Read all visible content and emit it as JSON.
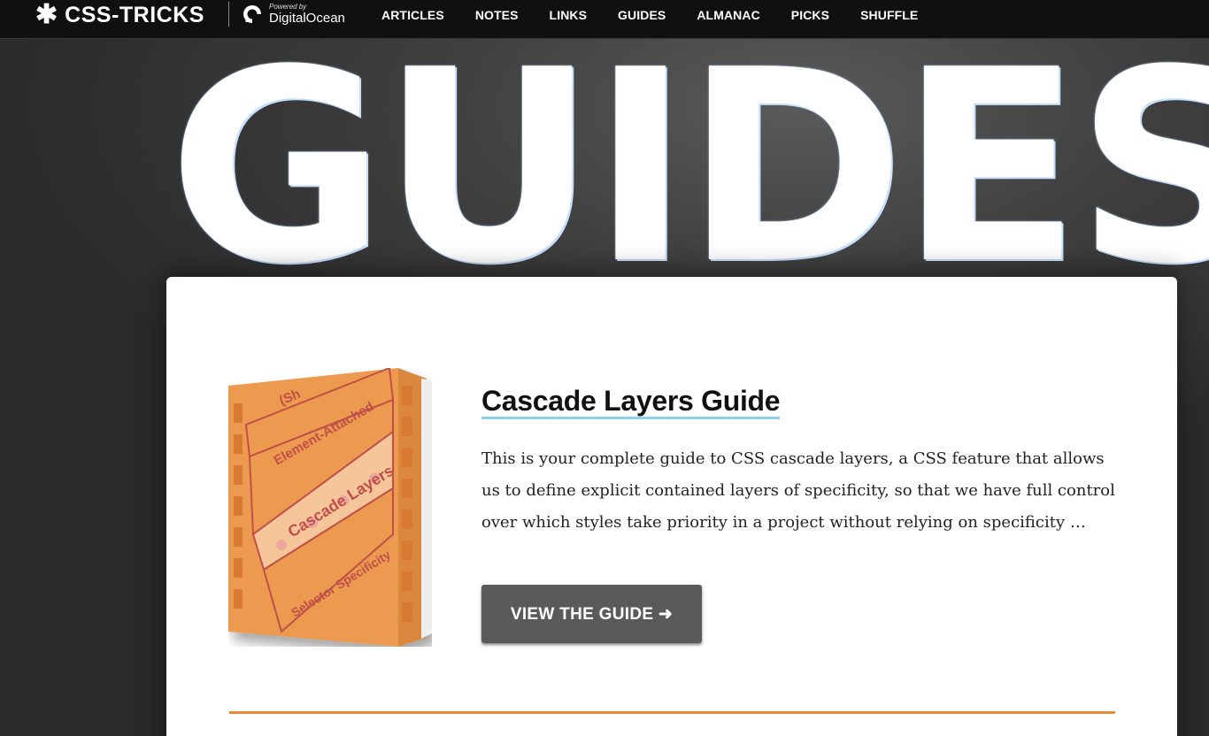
{
  "header": {
    "logo_text": "CSS-TRICKS",
    "sponsor_powered": "Powered by",
    "sponsor_name": "DigitalOcean",
    "nav": [
      "ARTICLES",
      "NOTES",
      "LINKS",
      "GUIDES",
      "ALMANAC",
      "PICKS",
      "SHUFFLE"
    ]
  },
  "hero": {
    "title": "GUIDES"
  },
  "guide": {
    "title": "Cascade Layers Guide",
    "description": "This is your complete guide to CSS cascade layers, a CSS feature that allows us to define explicit contained layers of specificity, so that we have full control over which styles take priority in a project without relying on specificity …",
    "button_label": "VIEW THE GUIDE ➜",
    "cover_labels": [
      "(Sh",
      "Element-Attached",
      "Cascade Layers",
      "Selector Specificity"
    ]
  },
  "colors": {
    "accent_orange": "#e8893a",
    "link_underline": "#8fd0f2",
    "button_bg": "#5a5a5a",
    "book_orange": "#ec9a4f"
  },
  "icons": {
    "logo": "asterisk-icon",
    "sponsor": "digitalocean-icon"
  }
}
